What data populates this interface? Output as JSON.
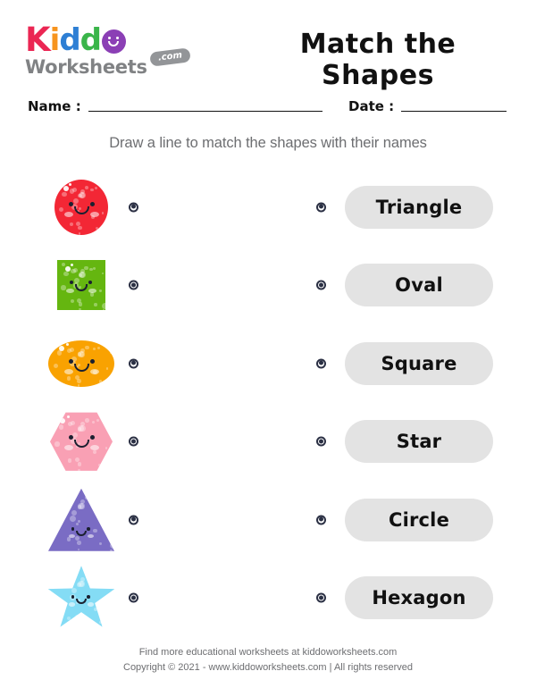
{
  "header": {
    "logo": {
      "brand_part1": "Kiddo",
      "letters": [
        {
          "char": "K",
          "color": "#eb2653"
        },
        {
          "char": "i",
          "color": "#f7941e"
        },
        {
          "char": "d",
          "color": "#2e7fd4"
        },
        {
          "char": "d",
          "color": "#3ab54a"
        }
      ],
      "o_letter_color": "#8b3fb5",
      "brand_part2": "Worksheets",
      "badge": ".com"
    },
    "title": "Match the Shapes"
  },
  "fields": {
    "name_label": "Name :",
    "name_value": "",
    "date_label": "Date :",
    "date_value": ""
  },
  "instruction": "Draw a line to match the shapes with their names",
  "rows": [
    {
      "shape": "circle",
      "color": "#f32735",
      "label": "Triangle"
    },
    {
      "shape": "square",
      "color": "#65b610",
      "label": "Oval"
    },
    {
      "shape": "oval",
      "color": "#f9a201",
      "label": "Square"
    },
    {
      "shape": "hexagon",
      "color": "#f9a0b4",
      "label": "Star"
    },
    {
      "shape": "triangle",
      "color": "#7a6cc4",
      "label": "Circle"
    },
    {
      "shape": "star",
      "color": "#84dcf5",
      "label": "Hexagon"
    }
  ],
  "footer": {
    "line1": "Find more educational worksheets at kiddoworksheets.com",
    "line2": "Copyright © 2021 - www.kiddoworksheets.com  |  All rights reserved"
  }
}
